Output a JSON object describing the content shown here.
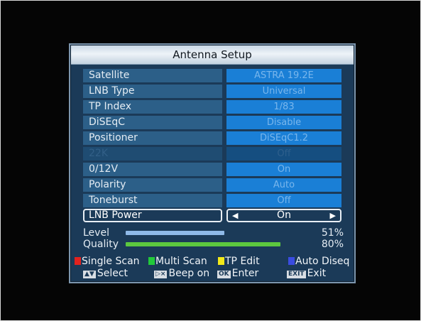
{
  "title": "Antenna Setup",
  "rows": [
    {
      "label": "Satellite",
      "value": "ASTRA 19.2E"
    },
    {
      "label": "LNB Type",
      "value": "Universal"
    },
    {
      "label": "TP Index",
      "value": "1/83"
    },
    {
      "label": "DiSEqC",
      "value": "Disable"
    },
    {
      "label": "Positioner",
      "value": "DiSEqC1.2"
    },
    {
      "label": "22K",
      "value": "Off",
      "disabled": true
    },
    {
      "label": "0/12V",
      "value": "On"
    },
    {
      "label": "Polarity",
      "value": "Auto"
    },
    {
      "label": "Toneburst",
      "value": "Off"
    },
    {
      "label": "LNB Power",
      "value": "On",
      "selected": true
    }
  ],
  "signal": {
    "level_label": "Level",
    "level_pct": "51%",
    "level_value": 0.51,
    "quality_label": "Quality",
    "quality_pct": "80%",
    "quality_value": 0.8,
    "level_color": "#8fb9e8",
    "quality_color": "#5cc83f"
  },
  "legend": {
    "single_scan": "Single Scan",
    "multi_scan": "Multi Scan",
    "tp_edit": "TP Edit",
    "auto_diseq": "Auto Diseq",
    "select": "Select",
    "beep": "Beep on",
    "enter": "Enter",
    "exit": "Exit",
    "ok_key": "OK",
    "exit_key": "EXIT"
  },
  "colors": {
    "red": "#e2221e",
    "green": "#22c93a",
    "yellow": "#f2e91a",
    "blue": "#3a4ce0",
    "panel": "#1b3a58",
    "value_box": "#1a7fd6"
  },
  "icons": {
    "left": "left-arrow-icon",
    "right": "right-arrow-icon",
    "updown": "up-down-key-icon",
    "mute": "mute-key-icon"
  }
}
